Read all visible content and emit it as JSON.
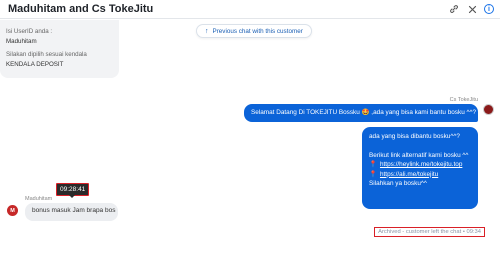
{
  "header": {
    "title": "Maduhitam and Cs TokeJitu",
    "actions": [
      "link-icon",
      "close-icon",
      "info-icon"
    ]
  },
  "previous_chat": {
    "lines": [
      "Isi UserID anda :",
      "Maduhitam",
      "Silakan dipilih sesuai kendala",
      "KENDALA DEPOSIT"
    ]
  },
  "prev_button": {
    "label": "Previous chat with this customer"
  },
  "agent": {
    "name": "Cs TokeJitu",
    "message1": "Selamat Datang Di TOKEJITU Bossku 🤩 ,ada yang bisa kami bantu bosku ^^?",
    "message2": {
      "line1": "ada yang bisa dibantu bosku^^?",
      "line2": "Berikut link alternatif kami bosku ^^",
      "link1": "https://heylink.me/tokejitu.top",
      "link2": "https://ali.me/tokejitu",
      "line3": "Silahkan ya bosku^^"
    }
  },
  "tooltip": {
    "time": "09:28:41"
  },
  "customer": {
    "name": "Maduhitam",
    "avatar_initial": "M",
    "message": "bonus masuk Jam brapa bos"
  },
  "status": {
    "archived": "Archived - customer left the chat • 09:34"
  }
}
